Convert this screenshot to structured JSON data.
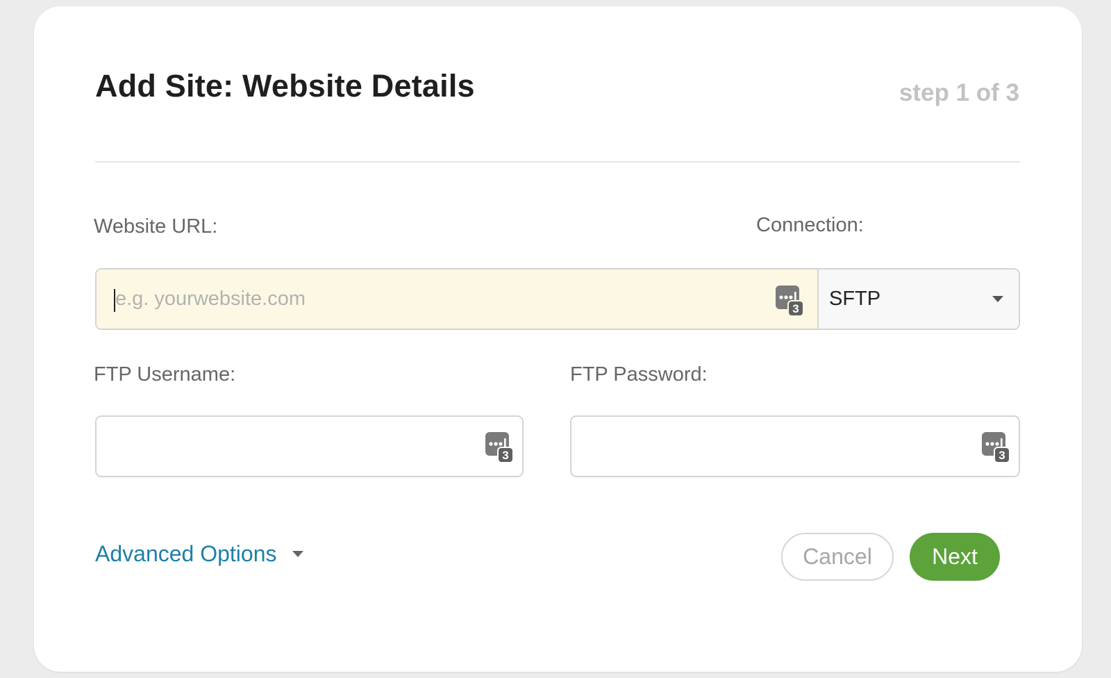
{
  "modal": {
    "title": "Add Site: Website Details",
    "step": "step 1 of 3"
  },
  "form": {
    "url_label": "Website URL:",
    "url_placeholder": "e.g. yourwebsite.com",
    "url_value": "",
    "connection_label": "Connection:",
    "connection_value": "SFTP",
    "username_label": "FTP Username:",
    "username_value": "",
    "password_label": "FTP Password:",
    "password_value": ""
  },
  "footer": {
    "advanced_label": "Advanced Options",
    "cancel_label": "Cancel",
    "next_label": "Next"
  },
  "icons": {
    "password_manager": "password-manager-icon",
    "dropdown": "chevron-down-icon"
  },
  "colors": {
    "accent_link": "#1d80a8",
    "primary_button": "#5ba33a",
    "autofill_highlight": "#fcf8e3"
  }
}
